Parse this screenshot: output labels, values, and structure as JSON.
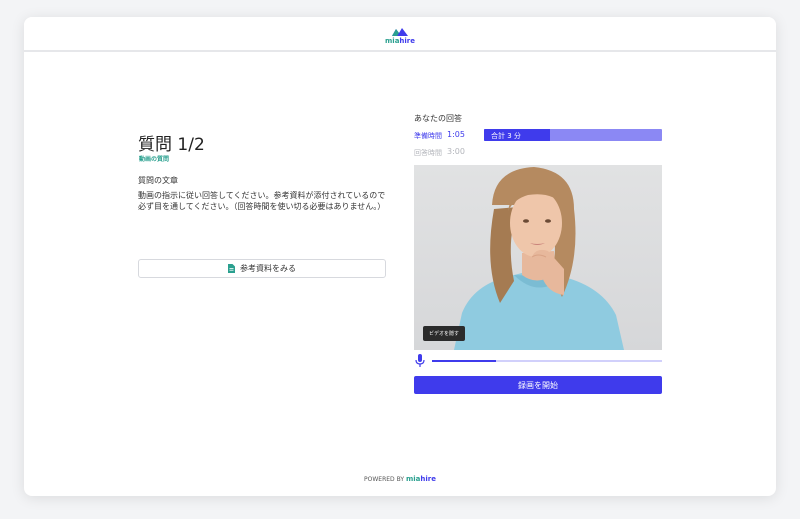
{
  "header": {
    "logo": {
      "mia": "mia",
      "hire": "hire"
    }
  },
  "question": {
    "title": "質問 1/2",
    "type": "動画の質問",
    "section_label": "質問の文章",
    "body": "動画の指示に従い回答してください。参考資料が添付されているので必ず目を通してください。（回答時間を使い切る必要はありません。）",
    "reference_button": "参考資料をみる",
    "reference_icon": "document-icon"
  },
  "answer": {
    "title": "あなたの回答",
    "prep_label": "準備時間",
    "prep_value": "1:05",
    "answer_label": "回答時間",
    "answer_value": "3:00",
    "total_label": "合計 3 分",
    "total_progress": 0.37,
    "hide_video_button": "ビデオを隠す",
    "mic_icon": "microphone-icon",
    "mic_level": 0.28,
    "record_button": "録画を開始"
  },
  "footer": {
    "powered_by": "POWERED BY",
    "mia": "mia",
    "hire": "hire"
  },
  "colors": {
    "accent": "#3f3bec",
    "accent_light": "#8b88f4",
    "brand_teal": "#2aa08f"
  }
}
